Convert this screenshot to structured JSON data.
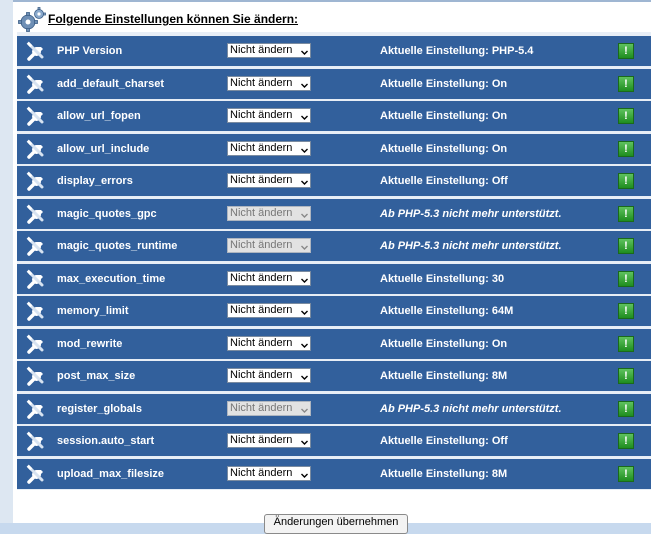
{
  "header": {
    "title": "Folgende Einstellungen können Sie ändern:",
    "icon": "gears-icon"
  },
  "colors": {
    "row_background": "#32609c",
    "info_button": "#2fa12f"
  },
  "rows": [
    {
      "name": "PHP Version",
      "select": "Nicht ändern",
      "disabled": false,
      "current": "Aktuelle Einstellung: PHP-5.4",
      "note": false
    },
    {
      "name": "add_default_charset",
      "select": "Nicht ändern",
      "disabled": false,
      "current": "Aktuelle Einstellung: On",
      "note": false
    },
    {
      "name": "allow_url_fopen",
      "select": "Nicht ändern",
      "disabled": false,
      "current": "Aktuelle Einstellung: On",
      "note": false
    },
    {
      "name": "allow_url_include",
      "select": "Nicht ändern",
      "disabled": false,
      "current": "Aktuelle Einstellung: On",
      "note": false
    },
    {
      "name": "display_errors",
      "select": "Nicht ändern",
      "disabled": false,
      "current": "Aktuelle Einstellung: Off",
      "note": false
    },
    {
      "name": "magic_quotes_gpc",
      "select": "Nicht ändern",
      "disabled": true,
      "current": "Ab PHP-5.3 nicht mehr unterstützt.",
      "note": true
    },
    {
      "name": "magic_quotes_runtime",
      "select": "Nicht ändern",
      "disabled": true,
      "current": "Ab PHP-5.3 nicht mehr unterstützt.",
      "note": true
    },
    {
      "name": "max_execution_time",
      "select": "Nicht ändern",
      "disabled": false,
      "current": "Aktuelle Einstellung: 30",
      "note": false
    },
    {
      "name": "memory_limit",
      "select": "Nicht ändern",
      "disabled": false,
      "current": "Aktuelle Einstellung: 64M",
      "note": false
    },
    {
      "name": "mod_rewrite",
      "select": "Nicht ändern",
      "disabled": false,
      "current": "Aktuelle Einstellung: On",
      "note": false
    },
    {
      "name": "post_max_size",
      "select": "Nicht ändern",
      "disabled": false,
      "current": "Aktuelle Einstellung: 8M",
      "note": false
    },
    {
      "name": "register_globals",
      "select": "Nicht ändern",
      "disabled": true,
      "current": "Ab PHP-5.3 nicht mehr unterstützt.",
      "note": true
    },
    {
      "name": "session.auto_start",
      "select": "Nicht ändern",
      "disabled": false,
      "current": "Aktuelle Einstellung: Off",
      "note": false
    },
    {
      "name": "upload_max_filesize",
      "select": "Nicht ändern",
      "disabled": false,
      "current": "Aktuelle Einstellung: 8M",
      "note": false
    }
  ],
  "info_button_label": "!",
  "submit_label": "Änderungen übernehmen"
}
